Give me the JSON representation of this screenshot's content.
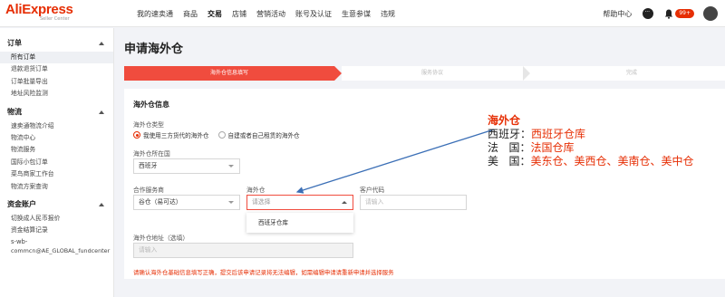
{
  "brand": {
    "logo_text": "AliExpress",
    "logo_sub": "Seller Center"
  },
  "topnav": [
    "我的速卖通",
    "商品",
    "交易",
    "店铺",
    "营销活动",
    "账号及认证",
    "生意参谋",
    "违规"
  ],
  "topbar": {
    "help": "帮助中心",
    "badge": "99+"
  },
  "sidebar": {
    "groups": [
      {
        "title": "订单",
        "items": [
          "所有订单",
          "退款退货订单",
          "订单批量导出",
          "地址风险监测"
        ]
      },
      {
        "title": "物流",
        "items": [
          "速卖通物流介绍",
          "物流中心",
          "物流服务",
          "国际小包订单",
          "菜鸟商家工作台",
          "物流方案查询"
        ]
      },
      {
        "title": "资金账户",
        "items": [
          "切换成人民币报价",
          "资金结算记录",
          "s-wb-",
          "commcn@AE_GLOBAL_fundcenter"
        ]
      }
    ]
  },
  "page": {
    "title": "申请海外仓"
  },
  "steps": [
    "海外仓信息填写",
    "服务协议",
    "完成"
  ],
  "form": {
    "section_title": "海外仓信息",
    "type_label": "海外仓类型",
    "radio_1": "我使用三方货代的海外仓",
    "radio_2": "自建或者自己租赁的海外仓",
    "country_label": "海外仓所在国",
    "country_value": "西班牙",
    "provider_label": "合作服务商",
    "provider_value": "谷仓（易可达）",
    "warehouse_label": "海外仓",
    "warehouse_placeholder": "请选择",
    "warehouse_option": "西班牙仓库",
    "customer_code_label": "客户代码",
    "customer_code_placeholder": "请输入",
    "address_label": "海外仓地址（选填）",
    "address_placeholder": "请输入",
    "warning": "请确认海外仓基础信息填写正确，提交后该申请记录将无法编辑，如需编辑申请请重新申请并选择服务"
  },
  "annotation": {
    "title": "海外仓",
    "lines": [
      {
        "key": "西班牙：",
        "value": "西班牙仓库"
      },
      {
        "key": "法   国：",
        "value": "法国仓库"
      },
      {
        "key": "美   国：",
        "value": "美东仓、美西仓、美南仓、美中仓"
      }
    ]
  },
  "colors": {
    "accent": "#e62e04",
    "step_active": "#f04c3e",
    "annotation_arrow": "#3b6fb6"
  }
}
